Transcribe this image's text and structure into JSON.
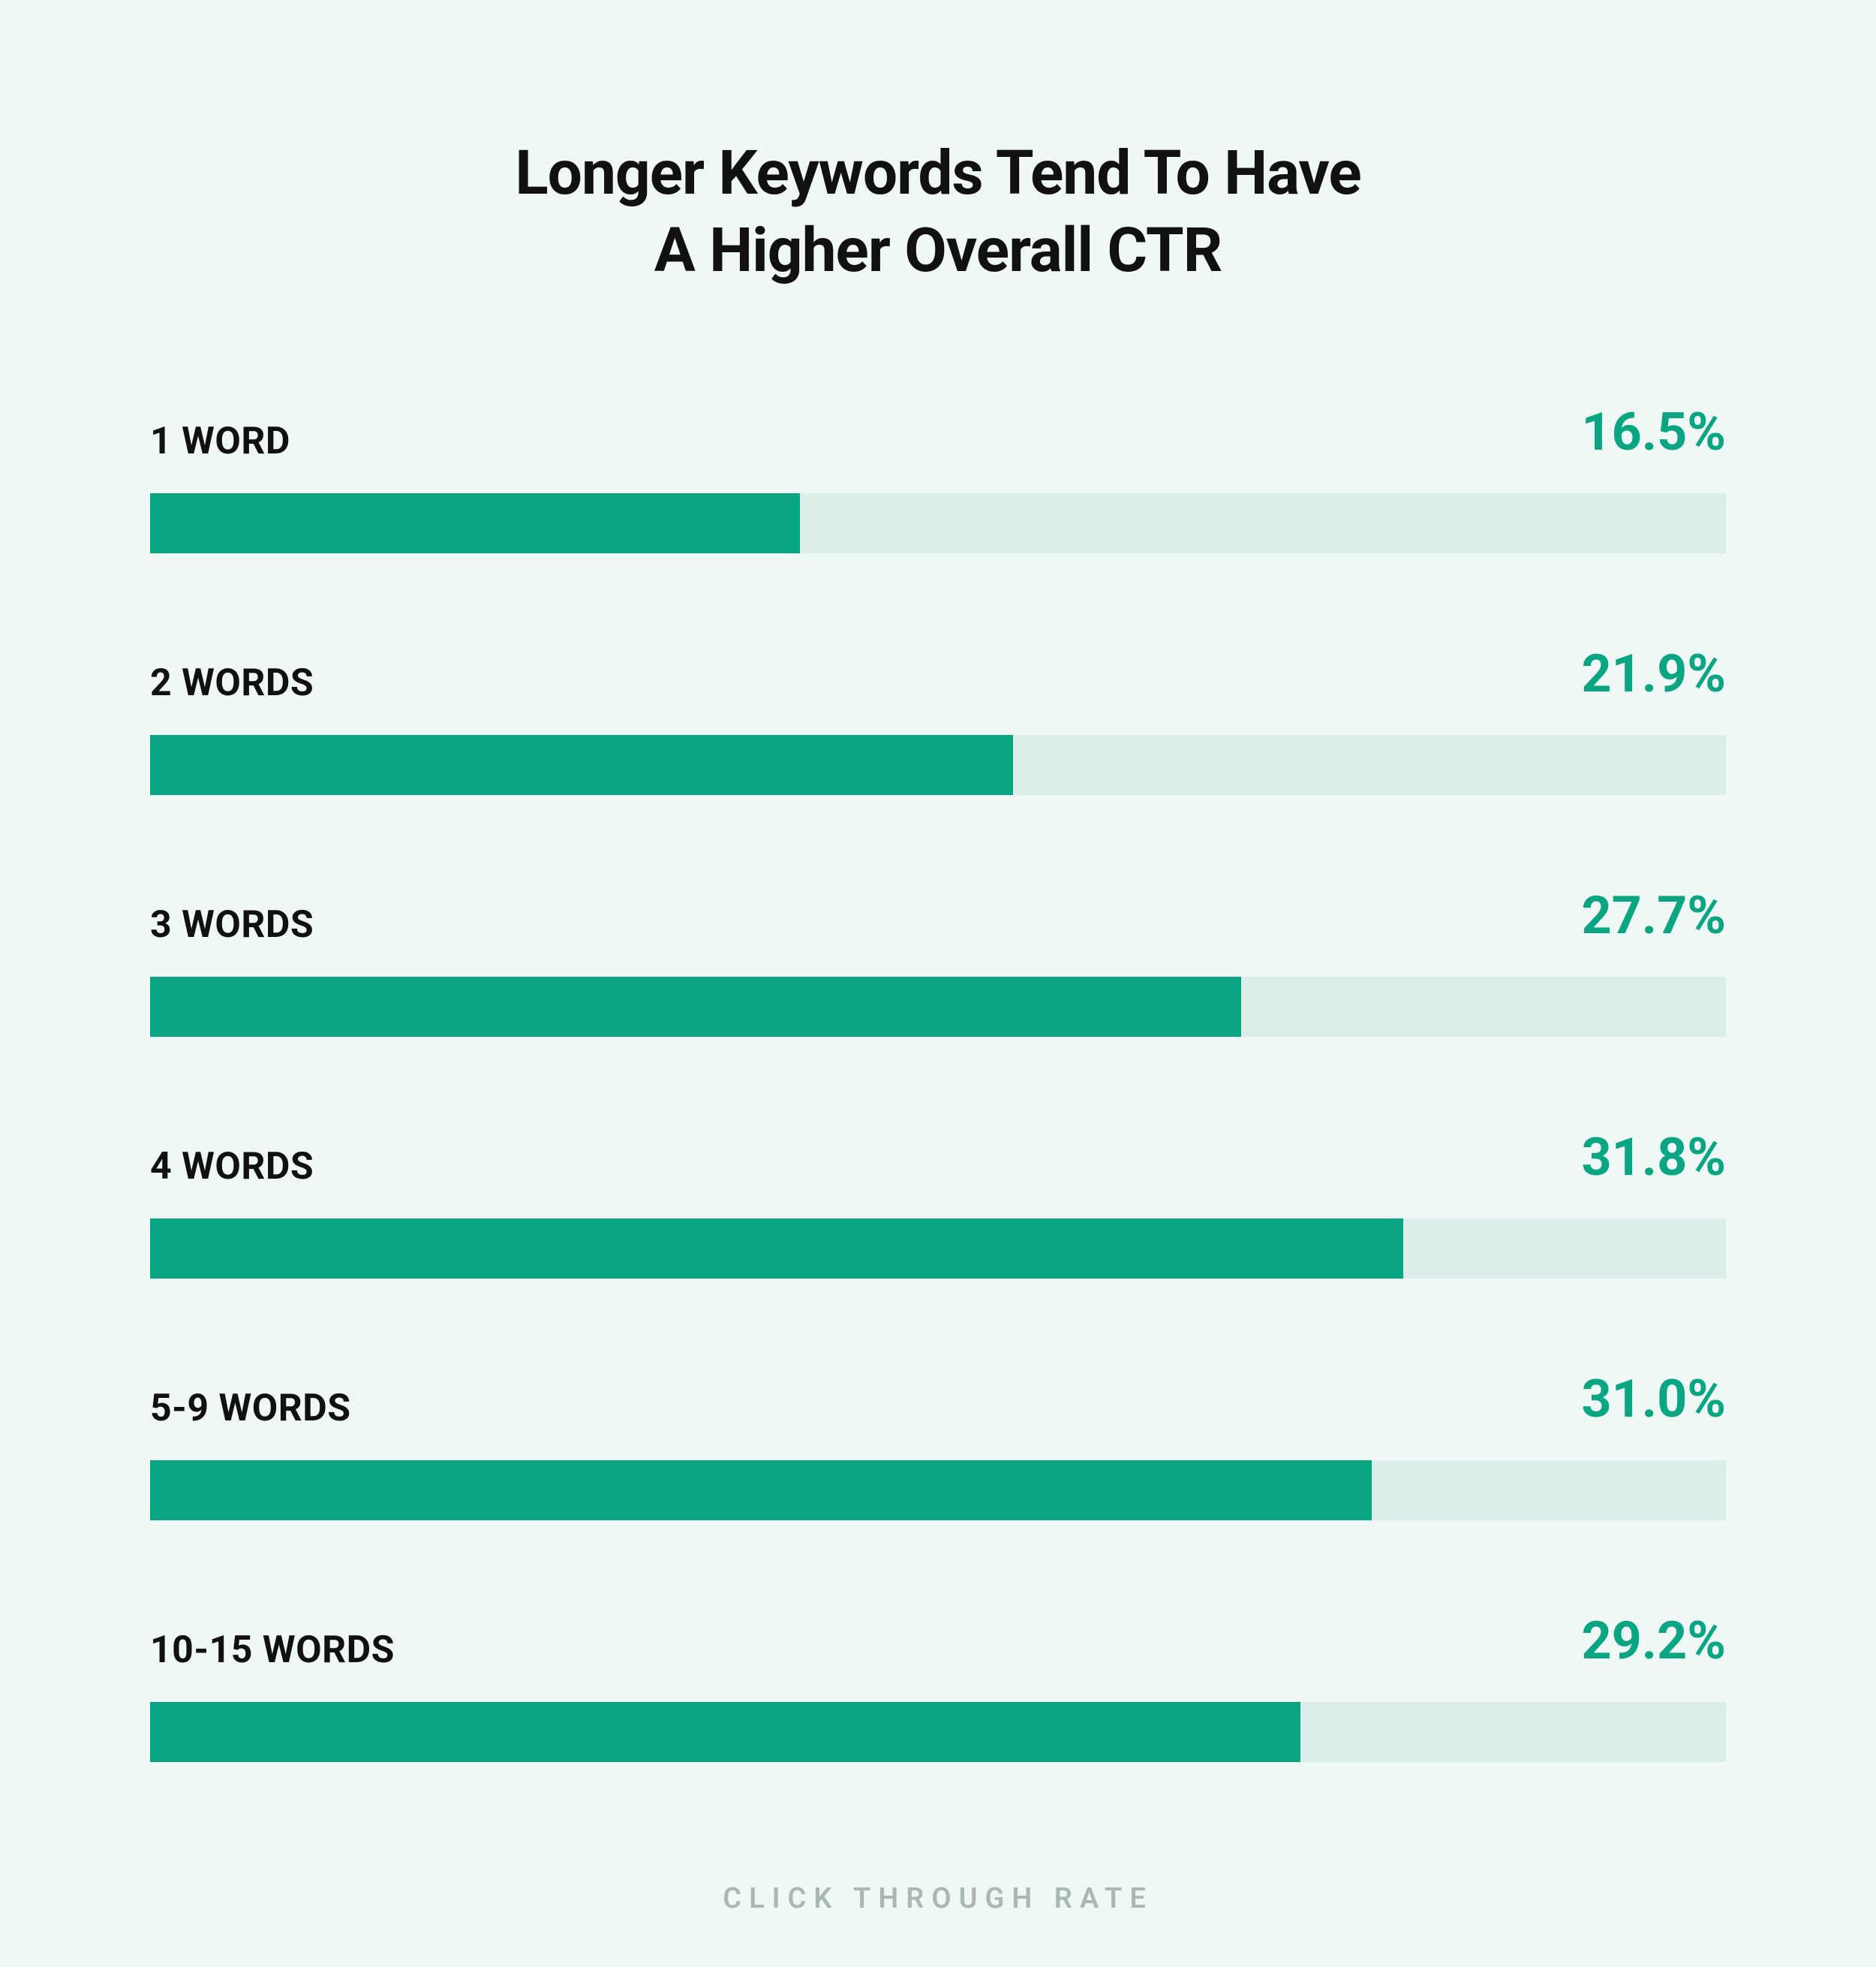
{
  "chart_data": {
    "type": "bar",
    "title": "Longer Keywords Tend To Have\nA Higher Overall CTR",
    "xlabel": "CLICK THROUGH RATE",
    "ylabel": "",
    "categories": [
      "1 WORD",
      "2 WORDS",
      "3 WORDS",
      "4 WORDS",
      "5-9 WORDS",
      "10-15 WORDS"
    ],
    "values": [
      16.5,
      21.9,
      27.7,
      31.8,
      31.0,
      29.2
    ],
    "value_labels": [
      "16.5%",
      "21.9%",
      "27.7%",
      "31.8%",
      "31.0%",
      "29.2%"
    ],
    "bar_scale_max": 40,
    "colors": {
      "bar": "#0aa582",
      "track": "#dceee9",
      "background": "#f0f8f6",
      "text": "#111"
    }
  }
}
